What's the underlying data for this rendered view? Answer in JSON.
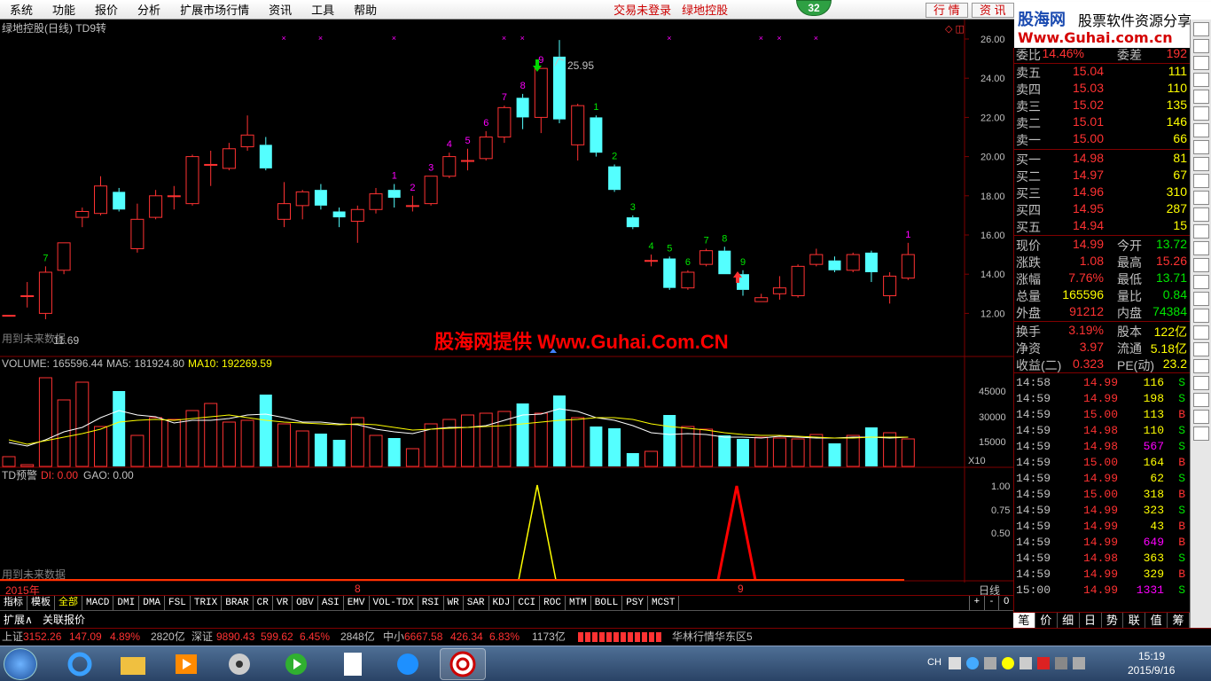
{
  "menu": {
    "items": [
      "系统",
      "功能",
      "报价",
      "分析",
      "扩展市场行情",
      "资讯",
      "工具",
      "帮助"
    ],
    "status_red_1": "交易未登录",
    "status_red_2": "绿地控股",
    "badge": "32",
    "btn_quote": "行 情",
    "btn_info": "资 讯"
  },
  "logo": {
    "line1a": "股海网",
    "line1b": "股票软件资源分享",
    "line2": "Www.Guhai.com.cn"
  },
  "chart": {
    "title": "绿地控股(日线) TD9转",
    "watermark": "股海网提供 Www.Guhai.Com.CN",
    "future_note_1": "用到未来数据",
    "low_label": "11.69",
    "high_label": "25.95",
    "price_ticks": [
      "26.00",
      "24.00",
      "22.00",
      "20.00",
      "18.00",
      "16.00",
      "14.00",
      "12.00"
    ],
    "volume_label": "VOLUME: 165596.44",
    "ma5_label": "MA5: 181924.80",
    "ma10_label": "MA10: 192269.59",
    "volume_ticks": [
      "45000",
      "30000",
      "15000"
    ],
    "volume_unit": "X10",
    "td_title": "TD预警",
    "td_di": "DI: 0.00",
    "td_gao": "GAO: 0.00",
    "td_ticks": [
      "1.00",
      "0.75",
      "0.50"
    ],
    "future_note_2": "用到未来数据",
    "date_year": "2015年",
    "date_m8": "8",
    "date_m9": "9",
    "period": "日线"
  },
  "candles": [
    {
      "o": 11.9,
      "c": 11.9,
      "h": 11.9,
      "l": 11.9
    },
    {
      "o": 12.9,
      "c": 12.9,
      "h": 13.6,
      "l": 12.3
    },
    {
      "o": 12.0,
      "c": 14.1,
      "h": 14.4,
      "l": 11.7
    },
    {
      "o": 14.2,
      "c": 15.6,
      "h": 15.6,
      "l": 14.0
    },
    {
      "o": 16.9,
      "c": 17.2,
      "h": 17.4,
      "l": 16.4
    },
    {
      "o": 17.1,
      "c": 18.5,
      "h": 19.0,
      "l": 17.0
    },
    {
      "o": 18.2,
      "c": 17.3,
      "h": 18.4,
      "l": 17.2
    },
    {
      "o": 15.3,
      "c": 16.8,
      "h": 17.6,
      "l": 15.1
    },
    {
      "o": 16.9,
      "c": 18.0,
      "h": 18.3,
      "l": 16.8
    },
    {
      "o": 18.0,
      "c": 18.0,
      "h": 18.5,
      "l": 17.3
    },
    {
      "o": 17.6,
      "c": 20.0,
      "h": 20.1,
      "l": 17.5
    },
    {
      "o": 19.6,
      "c": 19.6,
      "h": 20.3,
      "l": 18.5
    },
    {
      "o": 19.4,
      "c": 20.4,
      "h": 20.7,
      "l": 19.3
    },
    {
      "o": 20.5,
      "c": 21.1,
      "h": 22.1,
      "l": 20.3
    },
    {
      "o": 20.6,
      "c": 19.4,
      "h": 21.0,
      "l": 19.3
    },
    {
      "o": 16.8,
      "c": 17.6,
      "h": 18.7,
      "l": 16.4
    },
    {
      "o": 17.5,
      "c": 18.2,
      "h": 18.3,
      "l": 16.8
    },
    {
      "o": 18.3,
      "c": 17.5,
      "h": 18.6,
      "l": 17.3
    },
    {
      "o": 17.2,
      "c": 16.9,
      "h": 17.4,
      "l": 16.4
    },
    {
      "o": 16.7,
      "c": 17.3,
      "h": 17.5,
      "l": 15.6
    },
    {
      "o": 17.3,
      "c": 18.1,
      "h": 18.4,
      "l": 17.1
    },
    {
      "o": 18.3,
      "c": 17.9,
      "h": 18.6,
      "l": 17.4
    },
    {
      "o": 17.5,
      "c": 17.5,
      "h": 18.0,
      "l": 17.2
    },
    {
      "o": 17.6,
      "c": 19.0,
      "h": 19.0,
      "l": 17.5
    },
    {
      "o": 19.0,
      "c": 20.0,
      "h": 20.2,
      "l": 18.9
    },
    {
      "o": 19.8,
      "c": 19.8,
      "h": 20.4,
      "l": 19.3
    },
    {
      "o": 19.9,
      "c": 21.0,
      "h": 21.3,
      "l": 19.8
    },
    {
      "o": 21.0,
      "c": 22.5,
      "h": 22.6,
      "l": 20.7
    },
    {
      "o": 23.0,
      "c": 22.0,
      "h": 23.2,
      "l": 21.4
    },
    {
      "o": 22.0,
      "c": 24.5,
      "h": 24.5,
      "l": 21.2
    },
    {
      "o": 25.1,
      "c": 21.9,
      "h": 25.95,
      "l": 21.7
    },
    {
      "o": 20.6,
      "c": 22.6,
      "h": 22.7,
      "l": 19.8
    },
    {
      "o": 22.0,
      "c": 20.2,
      "h": 22.1,
      "l": 20.0
    },
    {
      "o": 19.5,
      "c": 18.3,
      "h": 19.6,
      "l": 18.2
    },
    {
      "o": 16.9,
      "c": 16.4,
      "h": 17.0,
      "l": 16.3
    },
    {
      "o": 14.7,
      "c": 14.7,
      "h": 15.0,
      "l": 14.4
    },
    {
      "o": 14.8,
      "c": 13.3,
      "h": 14.9,
      "l": 13.2
    },
    {
      "o": 13.3,
      "c": 14.1,
      "h": 14.2,
      "l": 13.2
    },
    {
      "o": 14.5,
      "c": 15.2,
      "h": 15.3,
      "l": 14.4
    },
    {
      "o": 15.2,
      "c": 14.0,
      "h": 15.4,
      "l": 14.0
    },
    {
      "o": 14.0,
      "c": 13.2,
      "h": 14.2,
      "l": 12.9
    },
    {
      "o": 12.6,
      "c": 12.8,
      "h": 13.0,
      "l": 12.6
    },
    {
      "o": 13.0,
      "c": 13.3,
      "h": 13.9,
      "l": 12.7
    },
    {
      "o": 12.9,
      "c": 14.4,
      "h": 14.5,
      "l": 12.8
    },
    {
      "o": 14.5,
      "c": 15.0,
      "h": 15.3,
      "l": 14.4
    },
    {
      "o": 14.7,
      "c": 14.2,
      "h": 14.9,
      "l": 14.1
    },
    {
      "o": 14.2,
      "c": 15.0,
      "h": 15.1,
      "l": 14.1
    },
    {
      "o": 15.1,
      "c": 14.1,
      "h": 15.2,
      "l": 13.6
    },
    {
      "o": 12.9,
      "c": 13.9,
      "h": 14.1,
      "l": 12.5
    },
    {
      "o": 13.8,
      "c": 15.0,
      "h": 15.6,
      "l": 13.7
    }
  ],
  "volumes": [
    11,
    0,
    100,
    75,
    95,
    45,
    85,
    35,
    55,
    53,
    63,
    71,
    50,
    52,
    81,
    48,
    40,
    37,
    30,
    55,
    35,
    32,
    20,
    48,
    53,
    58,
    60,
    62,
    71,
    60,
    80,
    55,
    45,
    43,
    15,
    17,
    58,
    45,
    42,
    35,
    31,
    33,
    32,
    31,
    36,
    26,
    35,
    44,
    38,
    31
  ],
  "ma5": [
    27,
    23,
    30,
    39,
    44,
    55,
    63,
    58,
    56,
    49,
    52,
    52,
    54,
    58,
    59,
    55,
    50,
    50,
    48,
    47,
    42,
    39,
    37,
    42,
    44,
    44,
    46,
    52,
    58,
    59,
    65,
    62,
    55,
    52,
    46,
    38,
    36,
    37,
    36,
    33,
    33,
    32,
    34,
    33,
    32,
    32,
    33,
    33,
    32,
    33
  ],
  "ma10": [
    30,
    25,
    29,
    33,
    37,
    42,
    50,
    52,
    53,
    52,
    54,
    56,
    58,
    55,
    52,
    50,
    49,
    48,
    47,
    48,
    47,
    44,
    41,
    42,
    43,
    44,
    45,
    46,
    48,
    50,
    52,
    53,
    55,
    55,
    53,
    48,
    45,
    43,
    41,
    38,
    36,
    35,
    35,
    34,
    33,
    32,
    32,
    33,
    33,
    33
  ],
  "td_labels": [
    {
      "i": 2,
      "t": "7",
      "c": "g"
    },
    {
      "i": 21,
      "t": "1",
      "c": "m"
    },
    {
      "i": 22,
      "t": "2",
      "c": "m"
    },
    {
      "i": 23,
      "t": "3",
      "c": "m"
    },
    {
      "i": 24,
      "t": "4",
      "c": "m"
    },
    {
      "i": 25,
      "t": "5",
      "c": "m"
    },
    {
      "i": 26,
      "t": "6",
      "c": "m"
    },
    {
      "i": 27,
      "t": "7",
      "c": "m"
    },
    {
      "i": 28,
      "t": "8",
      "c": "m"
    },
    {
      "i": 29,
      "t": "9",
      "c": "m"
    },
    {
      "i": 32,
      "t": "1",
      "c": "g"
    },
    {
      "i": 33,
      "t": "2",
      "c": "g"
    },
    {
      "i": 34,
      "t": "3",
      "c": "g"
    },
    {
      "i": 35,
      "t": "4",
      "c": "g"
    },
    {
      "i": 36,
      "t": "5",
      "c": "g"
    },
    {
      "i": 37,
      "t": "6",
      "c": "g"
    },
    {
      "i": 38,
      "t": "7",
      "c": "g"
    },
    {
      "i": 39,
      "t": "8",
      "c": "g"
    },
    {
      "i": 40,
      "t": "9",
      "c": "g"
    },
    {
      "i": 49,
      "t": "1",
      "c": "m"
    }
  ],
  "x_markers": [
    15,
    17,
    21,
    27,
    28,
    36,
    41,
    42,
    44
  ],
  "orderbook": {
    "weibi": {
      "label": "委比",
      "pct": "14.46%",
      "label2": "委差",
      "val": "192"
    },
    "sells": [
      {
        "label": "卖五",
        "price": "15.04",
        "vol": "111"
      },
      {
        "label": "卖四",
        "price": "15.03",
        "vol": "110"
      },
      {
        "label": "卖三",
        "price": "15.02",
        "vol": "135"
      },
      {
        "label": "卖二",
        "price": "15.01",
        "vol": "146"
      },
      {
        "label": "卖一",
        "price": "15.00",
        "vol": "66"
      }
    ],
    "buys": [
      {
        "label": "买一",
        "price": "14.98",
        "vol": "81"
      },
      {
        "label": "买二",
        "price": "14.97",
        "vol": "67"
      },
      {
        "label": "买三",
        "price": "14.96",
        "vol": "310"
      },
      {
        "label": "买四",
        "price": "14.95",
        "vol": "287"
      },
      {
        "label": "买五",
        "price": "14.94",
        "vol": "15"
      }
    ],
    "stats": [
      {
        "l1": "现价",
        "v1": "14.99",
        "c1": "red",
        "l2": "今开",
        "v2": "13.72",
        "c2": "grn"
      },
      {
        "l1": "涨跌",
        "v1": "1.08",
        "c1": "red",
        "l2": "最高",
        "v2": "15.26",
        "c2": "red"
      },
      {
        "l1": "涨幅",
        "v1": "7.76%",
        "c1": "red",
        "l2": "最低",
        "v2": "13.71",
        "c2": "grn"
      },
      {
        "l1": "总量",
        "v1": "165596",
        "c1": "yel",
        "l2": "量比",
        "v2": "0.84",
        "c2": "grn"
      },
      {
        "l1": "外盘",
        "v1": "91212",
        "c1": "red",
        "l2": "内盘",
        "v2": "74384",
        "c2": "grn"
      }
    ],
    "stats2": [
      {
        "l1": "换手",
        "v1": "3.19%",
        "l2": "股本",
        "v2": "122亿"
      },
      {
        "l1": "净资",
        "v1": "3.97",
        "l2": "流通",
        "v2": "5.18亿"
      },
      {
        "l1": "收益(二)",
        "v1": "0.323",
        "l2": "PE(动)",
        "v2": "23.2"
      }
    ]
  },
  "ticks": [
    {
      "t": "14:58",
      "p": "14.99",
      "v": "116",
      "d": "S"
    },
    {
      "t": "14:59",
      "p": "14.99",
      "v": "198",
      "d": "S"
    },
    {
      "t": "14:59",
      "p": "15.00",
      "v": "113",
      "d": "B"
    },
    {
      "t": "14:59",
      "p": "14.98",
      "v": "110",
      "d": "S"
    },
    {
      "t": "14:59",
      "p": "14.98",
      "v": "567",
      "d": "S",
      "vm": true
    },
    {
      "t": "14:59",
      "p": "15.00",
      "v": "164",
      "d": "B"
    },
    {
      "t": "14:59",
      "p": "14.99",
      "v": "62",
      "d": "S"
    },
    {
      "t": "14:59",
      "p": "15.00",
      "v": "318",
      "d": "B"
    },
    {
      "t": "14:59",
      "p": "14.99",
      "v": "323",
      "d": "S"
    },
    {
      "t": "14:59",
      "p": "14.99",
      "v": "43",
      "d": "B"
    },
    {
      "t": "14:59",
      "p": "14.99",
      "v": "649",
      "d": "B",
      "vm": true
    },
    {
      "t": "14:59",
      "p": "14.98",
      "v": "363",
      "d": "S"
    },
    {
      "t": "14:59",
      "p": "14.99",
      "v": "329",
      "d": "B"
    },
    {
      "t": "15:00",
      "p": "14.99",
      "v": "1331",
      "d": "S",
      "vm": true
    }
  ],
  "tabs": [
    "指标",
    "模板",
    "全部",
    "MACD",
    "DMI",
    "DMA",
    "FSL",
    "TRIX",
    "BRAR",
    "CR",
    "VR",
    "OBV",
    "ASI",
    "EMV",
    "VOL-TDX",
    "RSI",
    "WR",
    "SAR",
    "KDJ",
    "CCI",
    "ROC",
    "MTM",
    "BOLL",
    "PSY",
    "MCST"
  ],
  "tab_ctrl": [
    "+",
    "-",
    "0"
  ],
  "row3": {
    "expand": "扩展∧",
    "related": "关联报价"
  },
  "rtabs": [
    "笔",
    "价",
    "细",
    "日",
    "势",
    "联",
    "值",
    "筹"
  ],
  "status": {
    "sh_label": "上证",
    "sh_val": "3152.26",
    "sh_chg": "147.09",
    "sh_pct": "4.89%",
    "sh_amt": "2820亿",
    "sz_label": "深证",
    "sz_val": "9890.43",
    "sz_chg": "599.62",
    "sz_pct": "6.45%",
    "sz_amt": "2848亿",
    "zx_label": "中小",
    "zx_val": "6667.58",
    "zx_chg": "426.34",
    "zx_pct": "6.83%",
    "zx_amt": "1173亿",
    "server": "华林行情华东区5"
  },
  "taskbar": {
    "time": "15:19",
    "date": "2015/9/16",
    "lang": "CH"
  },
  "colors": {
    "up": "#ff3232",
    "down": "#54ffff",
    "ma5": "#ffffff",
    "ma10": "#ffff00",
    "td": "#ffff00",
    "tdred": "#ff0000"
  }
}
